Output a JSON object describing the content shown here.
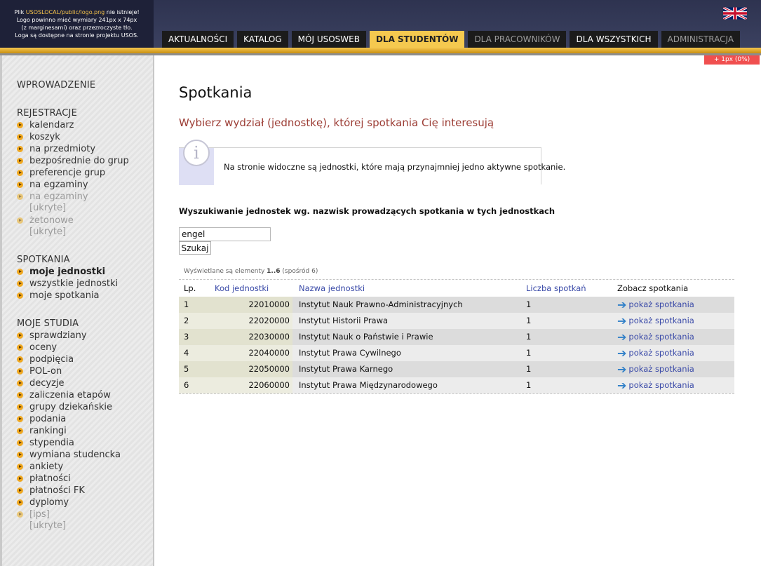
{
  "header": {
    "logo_warning": {
      "line1_pre": "Plik ",
      "line1_path": "USOSLOCAL/public/logo.png",
      "line1_post": " nie istnieje!",
      "line2": "Logo powinno mieć wymiary 241px x 74px",
      "line3": "(z marginesami) oraz przezroczyste tło.",
      "line4": "Loga są dostępne na stronie projektu USOS."
    },
    "tabs": [
      {
        "label": "AKTUALNOŚCI",
        "state": "normal"
      },
      {
        "label": "KATALOG",
        "state": "normal"
      },
      {
        "label": "MÓJ USOSWEB",
        "state": "normal"
      },
      {
        "label": "DLA STUDENTÓW",
        "state": "active"
      },
      {
        "label": "DLA PRACOWNIKÓW",
        "state": "disabled"
      },
      {
        "label": "DLA WSZYSTKICH",
        "state": "normal"
      },
      {
        "label": "ADMINISTRACJA",
        "state": "disabled"
      }
    ],
    "language_icon": "uk-flag-icon"
  },
  "sidebar": {
    "intro": "WPROWADZENIE",
    "rejestracje": {
      "title": "REJESTRACJE",
      "items": [
        "kalendarz",
        "koszyk",
        "na przedmioty",
        "bezpośrednie do grup",
        "preferencje grup",
        "na egzaminy"
      ],
      "disabled_item1": "na egzaminy",
      "disabled_item1_sub": "[ukryte]",
      "disabled_item2": "żetonowe",
      "disabled_item2_sub": "[ukryte]"
    },
    "spotkania": {
      "title": "SPOTKANIA",
      "items": [
        "moje jednostki",
        "wszystkie jednostki",
        "moje spotkania"
      ]
    },
    "moje_studia": {
      "title": "MOJE STUDIA",
      "items": [
        "sprawdziany",
        "oceny",
        "podpięcia",
        "POL-on",
        "decyzje",
        "zaliczenia etapów",
        "grupy dziekańskie",
        "podania",
        "rankingi",
        "stypendia",
        "wymiana studencka",
        "ankiety",
        "płatności",
        "płatności FK",
        "dyplomy"
      ],
      "disabled_item": "[ips]",
      "disabled_item_sub": "[ukryte]"
    }
  },
  "main": {
    "px_badge": "+ 1px (0%)",
    "title": "Spotkania",
    "subtitle": "Wybierz wydział (jednostkę), której spotkania Cię interesują",
    "info_icon_glyph": "i",
    "info_text": "Na stronie widoczne są jednostki, które mają przynajmniej jedno aktywne spotkanie.",
    "search_heading": "Wyszukiwanie jednostek wg. nazwisk prowadzących spotkania w tych jednostkach",
    "search_value": "engel",
    "search_button": "Szukaj",
    "results_info": {
      "prefix": "Wyświetlane są elementy ",
      "range": "1..6",
      "suffix": " (spośród 6)"
    },
    "table": {
      "headers": {
        "lp": "Lp.",
        "kod": "Kod jednostki",
        "nazwa": "Nazwa jednostki",
        "liczba": "Liczba spotkań",
        "zobacz": "Zobacz spotkania"
      },
      "link_label": "pokaż spotkania",
      "rows": [
        {
          "lp": "1",
          "kod": "22010000",
          "nazwa": "Instytut Nauk Prawno-Administracyjnych",
          "liczba": "1"
        },
        {
          "lp": "2",
          "kod": "22020000",
          "nazwa": "Instytut Historii Prawa",
          "liczba": "1"
        },
        {
          "lp": "3",
          "kod": "22030000",
          "nazwa": "Instytut Nauk o Państwie i Prawie",
          "liczba": "1"
        },
        {
          "lp": "4",
          "kod": "22040000",
          "nazwa": "Instytut Prawa Cywilnego",
          "liczba": "1"
        },
        {
          "lp": "5",
          "kod": "22050000",
          "nazwa": "Instytut Prawa Karnego",
          "liczba": "1"
        },
        {
          "lp": "6",
          "kod": "22060000",
          "nazwa": "Instytut Prawa Międzynarodowego",
          "liczba": "1"
        }
      ]
    }
  },
  "colors": {
    "accent": "#f5c94f",
    "header_bg": "#333850",
    "link": "#3a4aa8",
    "subtitle": "#9c3d35"
  }
}
